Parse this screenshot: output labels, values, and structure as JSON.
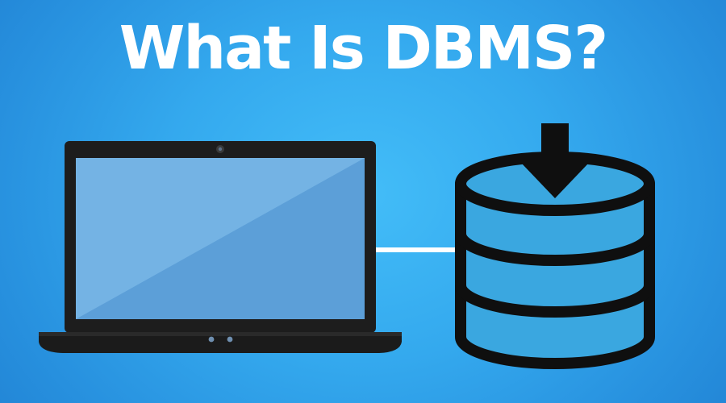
{
  "headline": {
    "text": "What Is DBMS?"
  },
  "colors": {
    "background_center": "#43bdf8",
    "background_edge": "#1f7fd1",
    "headline_text": "#ffffff",
    "laptop_body": "#1d1d1d",
    "laptop_screen_light": "#74b3e4",
    "laptop_screen_dark": "#5c9fd8",
    "connector_line": "#ffffff",
    "database_fill": "#3aa7e0",
    "database_outline": "#0f0f0f",
    "arrow": "#0f0f0f"
  },
  "icons": {
    "laptop": "laptop-icon",
    "database": "database-icon",
    "arrow": "arrow-down-icon",
    "connector": "connector-line"
  }
}
